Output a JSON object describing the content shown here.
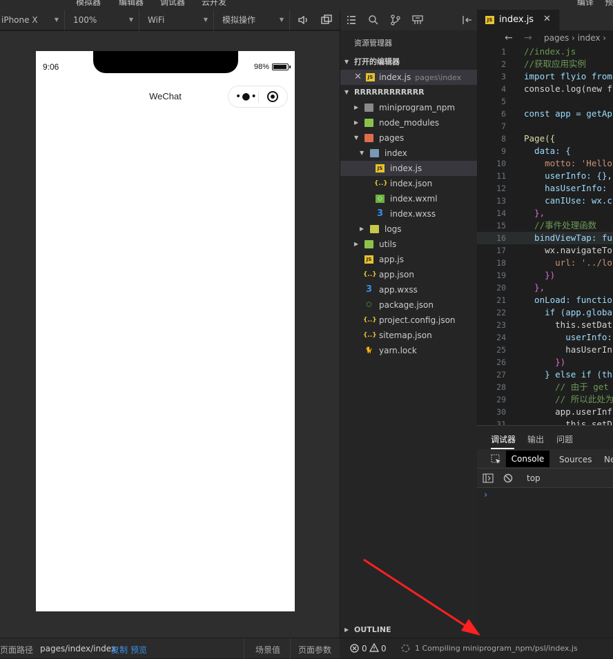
{
  "top_menu": [
    "模拟器",
    "编辑器",
    "调试器",
    "云开发",
    "编译",
    "预"
  ],
  "sim_toolbar": {
    "device": "iPhone X",
    "zoom": "100%",
    "network": "WiFi",
    "operation": "模拟操作"
  },
  "phone": {
    "time": "9:06",
    "battery": "98%",
    "nav_title": "WeChat"
  },
  "explorer": {
    "title": "资源管理器",
    "open_editors_label": "打开的编辑器",
    "open_editor": {
      "name": "index.js",
      "path": "pages\\index"
    },
    "project_label": "RRRRRRRRRRRR",
    "tree": [
      {
        "name": "miniprogram_npm",
        "icon": "folder-icon"
      },
      {
        "name": "node_modules",
        "icon": "node-folder-icon"
      },
      {
        "name": "pages",
        "icon": "pages-folder-icon"
      },
      {
        "name": "index",
        "icon": "folder-open-icon"
      },
      {
        "name": "index.js",
        "icon": "js-file-icon"
      },
      {
        "name": "index.json",
        "icon": "json-file-icon"
      },
      {
        "name": "index.wxml",
        "icon": "wxml-file-icon"
      },
      {
        "name": "index.wxss",
        "icon": "wxss-file-icon"
      },
      {
        "name": "logs",
        "icon": "logs-folder-icon"
      },
      {
        "name": "utils",
        "icon": "utils-folder-icon"
      },
      {
        "name": "app.js",
        "icon": "js-file-icon"
      },
      {
        "name": "app.json",
        "icon": "json-file-icon"
      },
      {
        "name": "app.wxss",
        "icon": "wxss-file-icon"
      },
      {
        "name": "package.json",
        "icon": "package-file-icon"
      },
      {
        "name": "project.config.json",
        "icon": "json-file-icon"
      },
      {
        "name": "sitemap.json",
        "icon": "json-file-icon"
      },
      {
        "name": "yarn.lock",
        "icon": "yarn-file-icon"
      }
    ],
    "outline_label": "OUTLINE"
  },
  "editor": {
    "tab_label": "index.js",
    "breadcrumb": "pages › index ›",
    "line_numbers": [
      "1",
      "2",
      "3",
      "4",
      "5",
      "6",
      "7",
      "8",
      "9",
      "10",
      "11",
      "12",
      "13",
      "14",
      "15",
      "16",
      "17",
      "18",
      "19",
      "20",
      "21",
      "22",
      "23",
      "24",
      "25",
      "26",
      "27",
      "28",
      "29",
      "30",
      "31"
    ],
    "lines": [
      "//index.js",
      "//获取应用实例",
      "import flyio from",
      "console.log(new f",
      "",
      "const app = getAp",
      "",
      "Page({",
      "  data: {",
      "    motto: 'Hello",
      "    userInfo: {},",
      "    hasUserInfo:",
      "    canIUse: wx.c",
      "  },",
      "  //事件处理函数",
      "  bindViewTap: fu",
      "    wx.navigateTo",
      "      url: '../lo",
      "    })",
      "  },",
      "  onLoad: functio",
      "    if (app.globa",
      "      this.setDat",
      "        userInfo:",
      "        hasUserIn",
      "      })",
      "    } else if (th",
      "      // 由于 get",
      "      // 所以此处为",
      "      app.userInf",
      "        this.setD"
    ]
  },
  "debugger": {
    "tabs": [
      "调试器",
      "输出",
      "问题"
    ],
    "devtools_tabs": [
      "Console",
      "Sources",
      "Ne"
    ],
    "context": "top",
    "prompt": "›"
  },
  "status": {
    "page_path_label": "页面路径",
    "page_path": "pages/index/index",
    "copy": "复制",
    "preview": "预览",
    "scene": "场景值",
    "page_params": "页面参数",
    "errors": "0",
    "warnings": "0",
    "compile_msg": "1 Compiling miniprogram_npm/psl/index.js"
  },
  "colors": {
    "accent_blue": "#3a8ee6",
    "annotation_arrow": "#ff2020",
    "js_icon": "#e8c22d"
  }
}
